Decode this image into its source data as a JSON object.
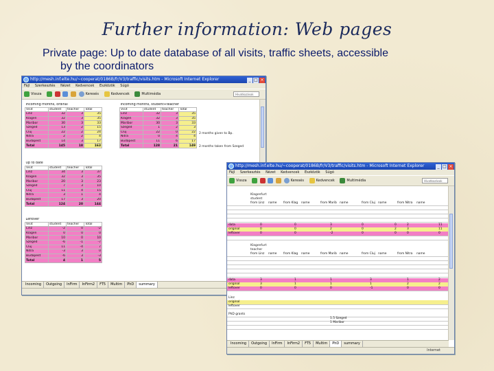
{
  "slide": {
    "title": "Further information: Web pages",
    "subtitle_line1": "Private page: Up to date database of all visits, traffic sheets, accessible",
    "subtitle_line2": "by the coordinators"
  },
  "window1": {
    "title": "http://mesh.inf.elte.hu/~cooperat/0186B/fr/V3/traffic/visits.htm - Microsoft Internet Explorer",
    "menu": [
      "Fájl",
      "Szerkesztés",
      "Nézet",
      "Kedvencek",
      "Eszközök",
      "Súgó"
    ],
    "toolbar": [
      "Vissza",
      "Keresés",
      "Kedvencek",
      "Multimédia"
    ],
    "links_label": "Hivatkozások",
    "tabs": [
      "Incoming",
      "Outgoing",
      "InFirm",
      "InFirm2",
      "FT5",
      "Multim",
      "PhD",
      "summary"
    ],
    "status": "",
    "tables": {
      "incoming_ordinal": {
        "caption": "Incoming months, ordinal",
        "headers": [
          "Visit",
          "student",
          "teacher",
          "Total"
        ],
        "rows": [
          [
            "Linz",
            "32",
            "3",
            "35"
          ],
          [
            "Klagen",
            "32",
            "3",
            "35"
          ],
          [
            "Maribor",
            "30",
            "3",
            "33"
          ],
          [
            "Szeged",
            "13",
            "2",
            "15"
          ],
          [
            "Cluj",
            "22",
            "2",
            "24"
          ],
          [
            "Nitra",
            "2",
            "2",
            "4"
          ],
          [
            "Budapest",
            "14",
            "3",
            "17"
          ]
        ],
        "total": [
          "Total",
          "145",
          "18",
          "163"
        ]
      },
      "incoming_student_teacher": {
        "caption": "Incoming months, student+teacher",
        "headers": [
          "Visit",
          "student",
          "teacher",
          "Total"
        ],
        "rows": [
          [
            "Linz",
            "32",
            "3",
            "35"
          ],
          [
            "Klagen",
            "32",
            "3",
            "35"
          ],
          [
            "Maribor",
            "30",
            "3",
            "33"
          ],
          [
            "Szeged",
            "1",
            "2",
            "3"
          ],
          [
            "Cluj",
            "22",
            "0",
            "22"
          ],
          [
            "Nitra",
            "0",
            "4",
            "4"
          ],
          [
            "Budapest",
            "11",
            "6",
            "17"
          ]
        ],
        "total": [
          "Total",
          "128",
          "21",
          "149"
        ],
        "note1": "2 months given to Bp.",
        "note2": "2 months taken from Szeged"
      },
      "up_to_date": {
        "caption": "Up to date",
        "headers": [
          "Visit",
          "student",
          "teacher",
          "Total"
        ],
        "rows": [
          [
            "Linz",
            "34",
            "3",
            "37"
          ],
          [
            "Klagen",
            "32",
            "3",
            "35"
          ],
          [
            "Maribor",
            "20",
            "3",
            "23"
          ],
          [
            "Szeged",
            "7",
            "3",
            "10"
          ],
          [
            "Cluj",
            "11",
            "4",
            "15"
          ],
          [
            "Nitra",
            "3",
            "1",
            "4"
          ],
          [
            "Budapest",
            "17",
            "3",
            "20"
          ]
        ],
        "total": [
          "Total",
          "124",
          "20",
          "144"
        ]
      },
      "leftover": {
        "caption": "Leftover",
        "headers": [
          "Visit",
          "student",
          "teacher",
          "Total"
        ],
        "rows": [
          [
            "Linz",
            "-2",
            "0",
            "-2"
          ],
          [
            "Klagen",
            "0",
            "0",
            "0"
          ],
          [
            "Maribor",
            "10",
            "0",
            "10"
          ],
          [
            "Szeged",
            "-6",
            "-1",
            "-7"
          ],
          [
            "Cluj",
            "11",
            "-4",
            "7"
          ],
          [
            "Nitra",
            "-3",
            "3",
            "0"
          ],
          [
            "Budapest",
            "-6",
            "3",
            "-3"
          ]
        ],
        "total": [
          "Total",
          "4",
          "1",
          "5"
        ]
      }
    }
  },
  "window2": {
    "title": "http://mesh.inf.elte.hu/~cooperat/0186B/fr/V3/traffic/visits.htm - Microsoft Internet Explorer",
    "menu": [
      "Fájl",
      "Szerkesztés",
      "Nézet",
      "Kedvencek",
      "Eszközök",
      "Súgó"
    ],
    "toolbar": [
      "Vissza",
      "Keresés",
      "Kedvencek",
      "Multimédia"
    ],
    "links_label": "Hivatkozások",
    "tabs": [
      "Incoming",
      "Outgoing",
      "InFirm",
      "InFirm2",
      "FT5",
      "Multim",
      "PhD",
      "summary"
    ],
    "status": "Internet",
    "section1_label": "Klagenfurt",
    "section1_sub": "student",
    "section2_label": "Klagenfurt",
    "section2_sub": "teacher",
    "headers": [
      "from Linz",
      "name",
      "from Klag",
      "name",
      "from Marib",
      "name",
      "from Cluj",
      "name",
      "from Nitra",
      "name"
    ],
    "row_labels": [
      "data",
      "original",
      "leftover"
    ],
    "rows_s1": [
      [
        "0",
        "0",
        "3",
        "0",
        "0",
        "2",
        "",
        "11"
      ],
      [
        "0",
        "0",
        "2",
        "0",
        "2",
        "3",
        "",
        "11"
      ],
      [
        "0",
        "0",
        "-2",
        "0",
        "0",
        "0",
        "",
        "0"
      ]
    ],
    "rows_s2": [
      [
        "3",
        "1",
        "1",
        "3",
        "1",
        "2"
      ],
      [
        "3",
        "1",
        "1",
        "1",
        "2",
        "2"
      ],
      [
        "0",
        "0",
        "0",
        "-1",
        "0",
        "0"
      ]
    ],
    "bottom_labels": [
      "Linz",
      "original",
      "leftover"
    ],
    "phd_label": "PhD grants",
    "phd_entries": [
      "1.5 Szeged",
      "1 Maribor"
    ]
  }
}
